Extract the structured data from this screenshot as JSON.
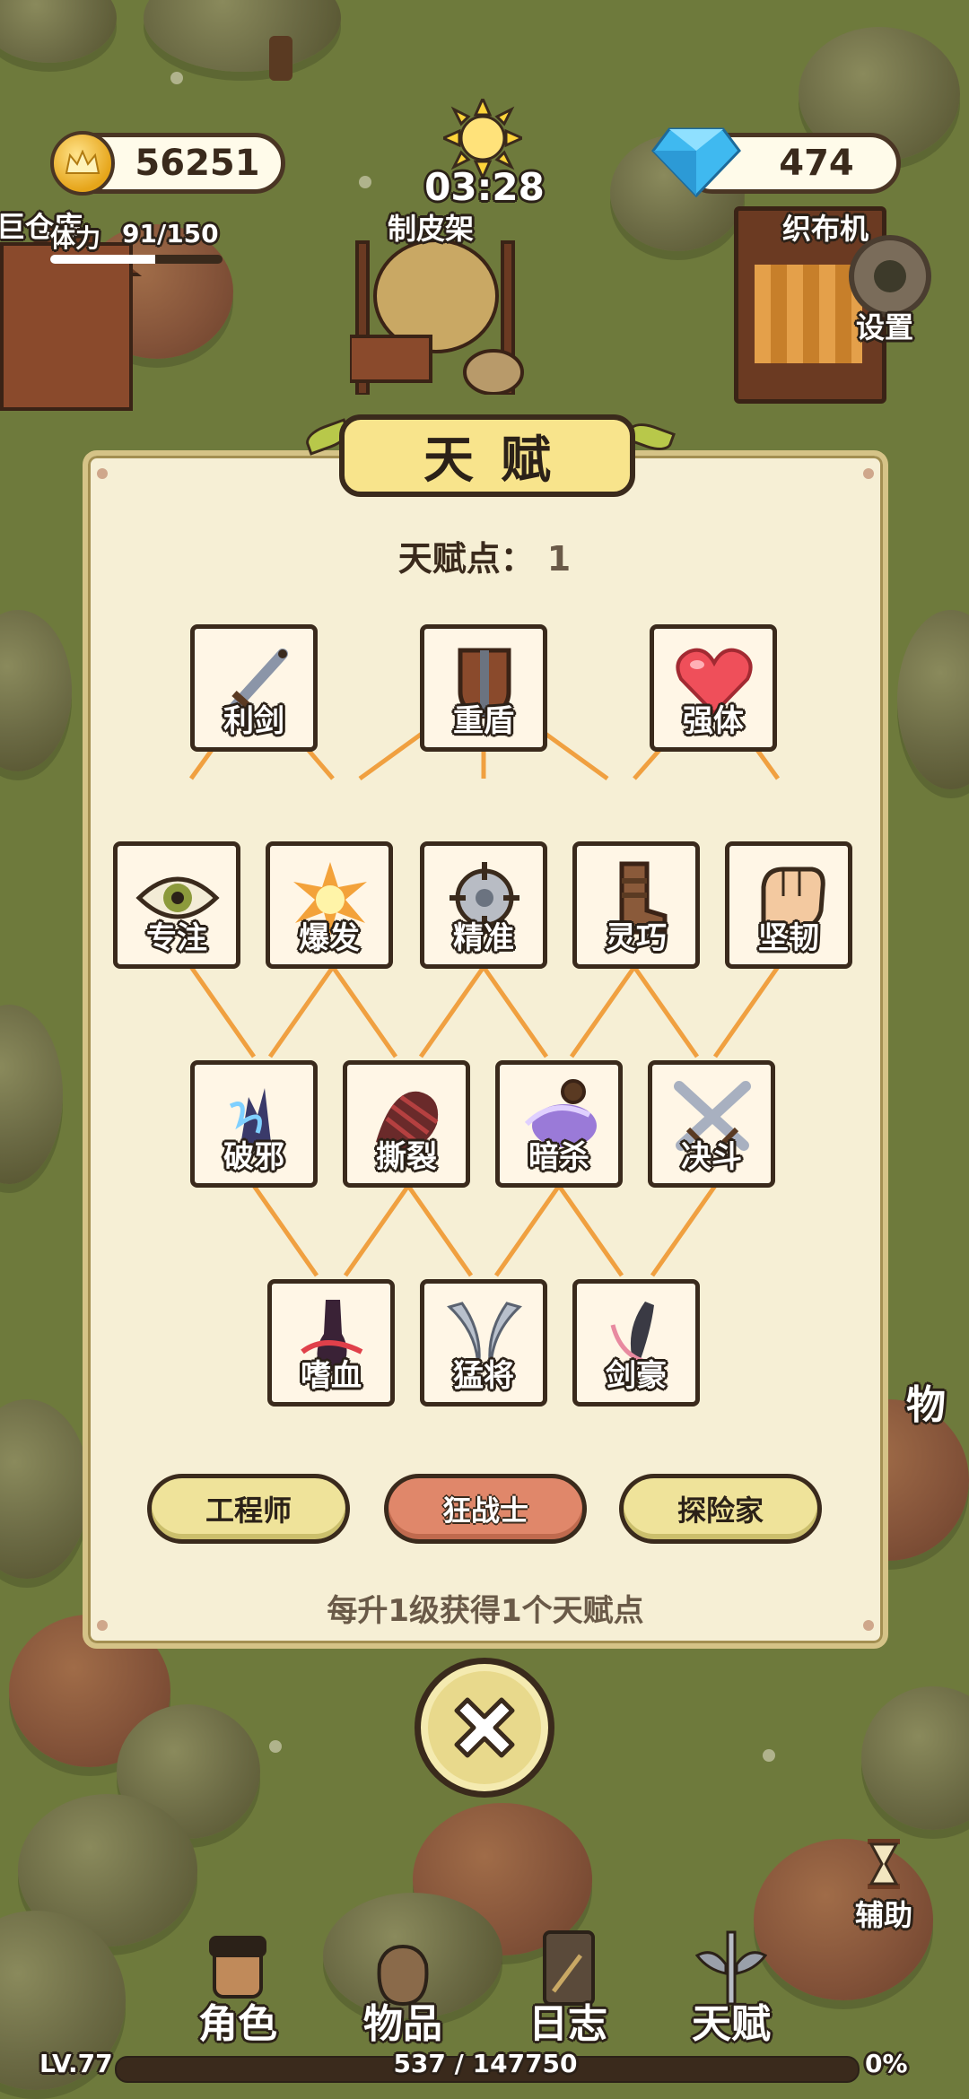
{
  "hud": {
    "gold": "56251",
    "gems": "474",
    "time": "03:28",
    "stamina_label": "体力",
    "stamina_value": "91/150",
    "stamina_fraction": 0.61
  },
  "map_labels": {
    "warehouse": "巨仓库",
    "tanning_rack": "制皮架",
    "loom": "织布机",
    "settings": "设置",
    "items_partial": "物"
  },
  "panel": {
    "title": "天赋",
    "points_label": "天赋点：",
    "points_value": "1",
    "hint": "每升1级获得1个天赋点"
  },
  "talents": {
    "row1": [
      {
        "name": "利剑",
        "icon": "sword-icon"
      },
      {
        "name": "重盾",
        "icon": "shield-icon"
      },
      {
        "name": "强体",
        "icon": "heart-icon"
      }
    ],
    "row2": [
      {
        "name": "专注",
        "icon": "eye-icon"
      },
      {
        "name": "爆发",
        "icon": "burst-icon"
      },
      {
        "name": "精准",
        "icon": "crosshair-icon"
      },
      {
        "name": "灵巧",
        "icon": "boots-icon"
      },
      {
        "name": "坚韧",
        "icon": "fist-icon"
      }
    ],
    "row3": [
      {
        "name": "破邪",
        "icon": "purify-icon"
      },
      {
        "name": "撕裂",
        "icon": "claw-icon"
      },
      {
        "name": "暗杀",
        "icon": "poison-icon"
      },
      {
        "name": "决斗",
        "icon": "crossed-swords-icon"
      }
    ],
    "row4": [
      {
        "name": "嗜血",
        "icon": "blood-icon"
      },
      {
        "name": "猛将",
        "icon": "blades-icon"
      },
      {
        "name": "剑豪",
        "icon": "slash-icon"
      }
    ]
  },
  "classes": [
    {
      "label": "工程师",
      "selected": false
    },
    {
      "label": "狂战士",
      "selected": true
    },
    {
      "label": "探险家",
      "selected": false
    }
  ],
  "nav": {
    "character": "角色",
    "items": "物品",
    "journal": "日志",
    "talent": "天赋",
    "assist": "辅助"
  },
  "footer": {
    "level": "LV.77",
    "xp": "537 / 147750",
    "xp_percent": "0%"
  },
  "colors": {
    "connector": "#f0a040",
    "panel_bg": "#f6efd5",
    "selected_class": "#e0876a",
    "class_button": "#efe39a"
  }
}
